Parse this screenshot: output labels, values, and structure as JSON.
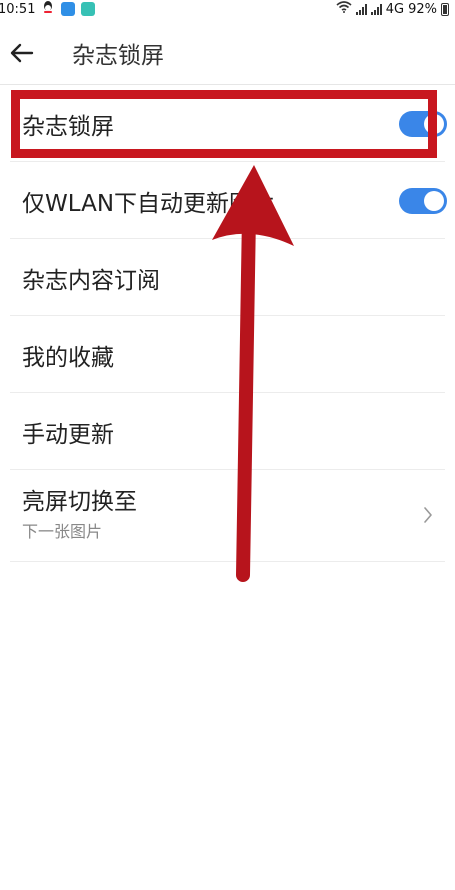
{
  "status_bar": {
    "time": "10:51",
    "network_type": "4G",
    "battery": "92%"
  },
  "app_bar": {
    "title": "杂志锁屏"
  },
  "settings": [
    {
      "id": "magazine-lockscreen",
      "label": "杂志锁屏",
      "control": "toggle",
      "enabled": true
    },
    {
      "id": "wlan-only-update",
      "label": "仅WLAN下自动更新图片",
      "control": "toggle",
      "enabled": true
    },
    {
      "id": "content-subscription",
      "label": "杂志内容订阅",
      "control": "none"
    },
    {
      "id": "my-favorites",
      "label": "我的收藏",
      "control": "none"
    },
    {
      "id": "manual-update",
      "label": "手动更新",
      "control": "none"
    },
    {
      "id": "screen-on-switch",
      "label": "亮屏切换至",
      "sublabel": "下一张图片",
      "control": "chevron"
    }
  ],
  "colors": {
    "toggle_on": "#3a86e8",
    "annotation_red": "#c8171f"
  }
}
